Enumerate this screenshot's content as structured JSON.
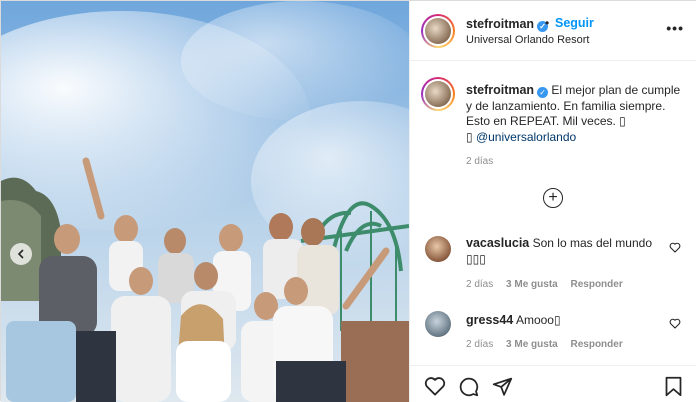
{
  "post": {
    "username": "stefroitman",
    "follow_label": "Seguir",
    "separator": "•",
    "location": "Universal Orlando Resort",
    "more_label": "•••",
    "verified_glyph": "✓",
    "caption": {
      "username": "stefroitman",
      "text": "El mejor plan de cumple y de lanzamiento. En familia siempre. Esto en REPEAT. Mil veces. ",
      "emoji_a": "▯",
      "emoji_b": "▯",
      "mention": "@universalorlando",
      "time": "2 días"
    },
    "load_more_glyph": "+",
    "comments": [
      {
        "username": "vacaslucia",
        "text": "Son lo mas del mundo",
        "emoji": "▯▯▯",
        "time": "2 días",
        "likes": "3 Me gusta",
        "reply": "Responder"
      },
      {
        "username": "gress44",
        "text": "Amooo▯",
        "time": "2 días",
        "likes": "3 Me gusta",
        "reply": "Responder"
      }
    ],
    "icons": {
      "like": "heart-icon",
      "comment": "comment-icon",
      "share": "share-icon",
      "save": "bookmark-icon",
      "carousel_prev": "chevron-left-icon",
      "more": "more-options-icon"
    },
    "colors": {
      "link_blue": "#0095f6",
      "secondary_text": "#8e8e8e",
      "verified_blue": "#3897f0"
    }
  }
}
